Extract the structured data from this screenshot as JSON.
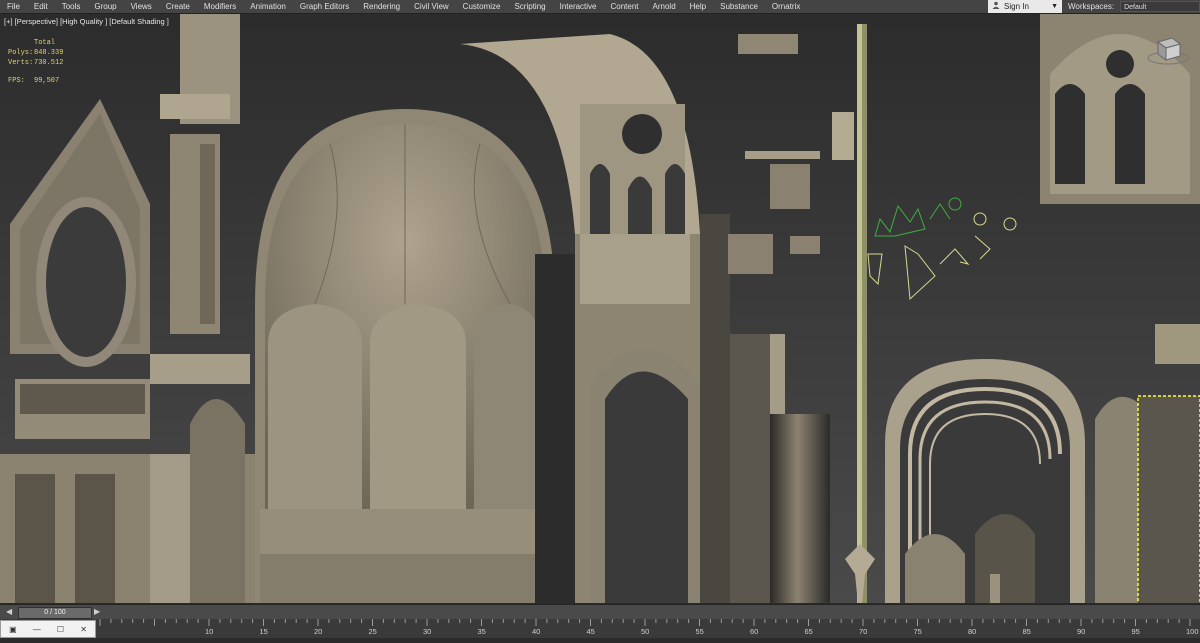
{
  "menu": {
    "items": [
      "File",
      "Edit",
      "Tools",
      "Group",
      "Views",
      "Create",
      "Modifiers",
      "Animation",
      "Graph Editors",
      "Rendering",
      "Civil View",
      "Customize",
      "Scripting",
      "Interactive",
      "Content",
      "Arnold",
      "Help",
      "Substance",
      "Ornatrix"
    ]
  },
  "account": {
    "signin_label": "Sign In"
  },
  "workspaces": {
    "label": "Workspaces:",
    "value": "Default"
  },
  "viewport": {
    "labels": "[+] [Perspective] [High Quality ] [Default Shading ]",
    "stats": {
      "header": "Total",
      "polys_label": "Polys:",
      "polys_value": "848.339",
      "verts_label": "Verts:",
      "verts_value": "730.512",
      "fps_label": "FPS:",
      "fps_value": "99,507"
    }
  },
  "timeline": {
    "slider_text": "0 / 100",
    "prev_icon": "chevron-left-icon",
    "next_icon": "chevron-right-icon",
    "ruler_ticks": [
      "10",
      "15",
      "20",
      "25",
      "30",
      "35",
      "40",
      "45",
      "50",
      "55",
      "60",
      "65",
      "70",
      "75",
      "80",
      "85",
      "90",
      "95",
      "100"
    ]
  },
  "colors": {
    "menubar": "#444444",
    "viewport_bg": "#393939",
    "stone": "#8c8270",
    "stats_text": "#e2d36a",
    "spline_green": "#3fae3f",
    "spline_yellow": "#d8d890",
    "selection": "#ffff3a"
  }
}
